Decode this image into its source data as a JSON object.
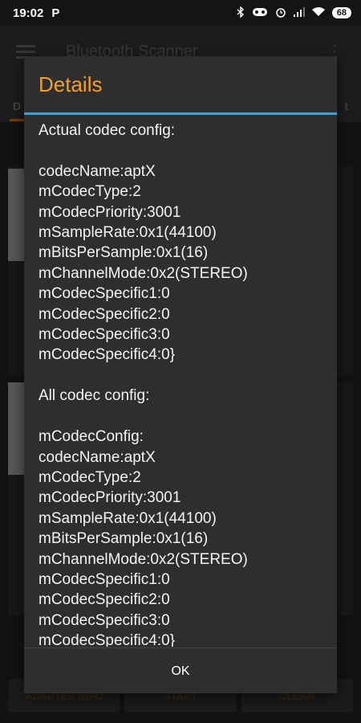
{
  "statusbar": {
    "time": "19:02",
    "app_indicator": "P",
    "battery": "68",
    "icons": [
      "bluetooth-icon",
      "vr-icon",
      "alarm-icon",
      "signal-icon",
      "wifi-icon"
    ]
  },
  "app": {
    "title": "Bluetooth Scanner",
    "tab_left": "D",
    "tab_right": "t",
    "buttons": [
      "ADAPTER INFO",
      "START",
      "CLEAR"
    ]
  },
  "dialog": {
    "title": "Details",
    "content": "Actual codec config:\n\ncodecName:aptX\nmCodecType:2\nmCodecPriority:3001\nmSampleRate:0x1(44100)\nmBitsPerSample:0x1(16)\nmChannelMode:0x2(STEREO)\nmCodecSpecific1:0\nmCodecSpecific2:0\nmCodecSpecific3:0\nmCodecSpecific4:0}\n\nAll codec config:\n\nmCodecConfig:\ncodecName:aptX\nmCodecType:2\nmCodecPriority:3001\nmSampleRate:0x1(44100)\nmBitsPerSample:0x1(16)\nmChannelMode:0x2(STEREO)\nmCodecSpecific1:0\nmCodecSpecific2:0\nmCodecSpecific3:0\nmCodecSpecific4:0}",
    "ok_label": "OK"
  },
  "colors": {
    "title": "#f0a030",
    "divider": "#3aa2d6"
  }
}
